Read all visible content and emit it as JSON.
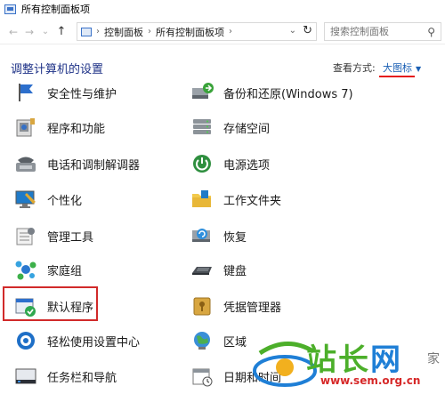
{
  "window": {
    "title": "所有控制面板项"
  },
  "nav": {
    "back": "←",
    "forward": "→",
    "dropdown": "⌄",
    "up": "↑"
  },
  "address": {
    "crumbs": [
      "控制面板",
      "所有控制面板项"
    ],
    "separator": "›",
    "dropdown": "⌄",
    "refresh": "↻"
  },
  "search": {
    "placeholder": "搜索控制面板",
    "icon": "search-icon"
  },
  "main": {
    "heading": "调整计算机的设置",
    "view_by_label": "查看方式:",
    "view_mode": "大图标",
    "view_mode_caret": "▼"
  },
  "items": [
    {
      "label": "安全性与维护",
      "icon": "flag-icon"
    },
    {
      "label": "备份和还原(Windows 7)",
      "icon": "backup-icon"
    },
    {
      "label": "程序和功能",
      "icon": "programs-icon"
    },
    {
      "label": "存储空间",
      "icon": "storage-icon"
    },
    {
      "label": "电话和调制解调器",
      "icon": "phone-modem-icon"
    },
    {
      "label": "电源选项",
      "icon": "power-icon"
    },
    {
      "label": "个性化",
      "icon": "personalization-icon"
    },
    {
      "label": "工作文件夹",
      "icon": "folder-icon"
    },
    {
      "label": "管理工具",
      "icon": "admin-tools-icon"
    },
    {
      "label": "恢复",
      "icon": "recovery-icon"
    },
    {
      "label": "家庭组",
      "icon": "homegroup-icon"
    },
    {
      "label": "键盘",
      "icon": "keyboard-icon"
    },
    {
      "label": "默认程序",
      "icon": "default-programs-icon"
    },
    {
      "label": "凭据管理器",
      "icon": "credential-icon"
    },
    {
      "label": "轻松使用设置中心",
      "icon": "ease-of-access-icon"
    },
    {
      "label": "区域",
      "icon": "region-icon"
    },
    {
      "label": "任务栏和导航",
      "icon": "taskbar-icon"
    },
    {
      "label": "日期和时间",
      "icon": "calendar-icon"
    }
  ],
  "watermark": {
    "text_green": "站长",
    "text_blue": "网",
    "side": "家",
    "url": "www.sem.org.cn"
  },
  "colors": {
    "accent": "#1a5fb4",
    "highlight": "#d12a2a",
    "heading": "#1e3287"
  }
}
